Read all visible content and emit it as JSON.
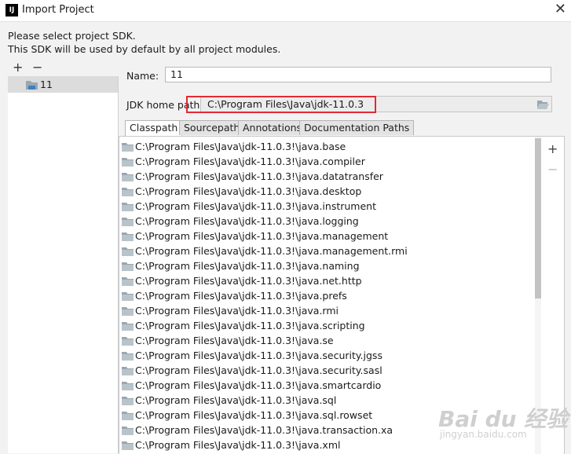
{
  "window": {
    "title": "Import Project",
    "logo_text": "IJ",
    "close_glyph": "✕"
  },
  "intro": {
    "line1": "Please select project SDK.",
    "line2": "This SDK will be used by default by all project modules."
  },
  "sdk_toolbar": {
    "add_glyph": "+",
    "remove_glyph": "−"
  },
  "sdk_list": {
    "items": [
      {
        "label": "11",
        "icon": "sdk-folder-icon"
      }
    ]
  },
  "form": {
    "name_label": "Name:",
    "name_value": "11",
    "home_label": "JDK home path:",
    "home_value": "C:\\Program Files\\Java\\jdk-11.0.3",
    "browse_icon": "folder-open-icon"
  },
  "tabs": [
    {
      "label": "Classpath",
      "active": true
    },
    {
      "label": "Sourcepath",
      "active": false
    },
    {
      "label": "Annotations",
      "active": false
    },
    {
      "label": "Documentation Paths",
      "active": false
    }
  ],
  "path_actions": {
    "add_glyph": "+",
    "remove_glyph": "−"
  },
  "classpath": [
    "C:\\Program Files\\Java\\jdk-11.0.3!\\java.base",
    "C:\\Program Files\\Java\\jdk-11.0.3!\\java.compiler",
    "C:\\Program Files\\Java\\jdk-11.0.3!\\java.datatransfer",
    "C:\\Program Files\\Java\\jdk-11.0.3!\\java.desktop",
    "C:\\Program Files\\Java\\jdk-11.0.3!\\java.instrument",
    "C:\\Program Files\\Java\\jdk-11.0.3!\\java.logging",
    "C:\\Program Files\\Java\\jdk-11.0.3!\\java.management",
    "C:\\Program Files\\Java\\jdk-11.0.3!\\java.management.rmi",
    "C:\\Program Files\\Java\\jdk-11.0.3!\\java.naming",
    "C:\\Program Files\\Java\\jdk-11.0.3!\\java.net.http",
    "C:\\Program Files\\Java\\jdk-11.0.3!\\java.prefs",
    "C:\\Program Files\\Java\\jdk-11.0.3!\\java.rmi",
    "C:\\Program Files\\Java\\jdk-11.0.3!\\java.scripting",
    "C:\\Program Files\\Java\\jdk-11.0.3!\\java.se",
    "C:\\Program Files\\Java\\jdk-11.0.3!\\java.security.jgss",
    "C:\\Program Files\\Java\\jdk-11.0.3!\\java.security.sasl",
    "C:\\Program Files\\Java\\jdk-11.0.3!\\java.smartcardio",
    "C:\\Program Files\\Java\\jdk-11.0.3!\\java.sql",
    "C:\\Program Files\\Java\\jdk-11.0.3!\\java.sql.rowset",
    "C:\\Program Files\\Java\\jdk-11.0.3!\\java.transaction.xa",
    "C:\\Program Files\\Java\\jdk-11.0.3!\\java.xml"
  ],
  "watermark": {
    "brand": "Bai du 经验",
    "site": "jingyan.baidu.com"
  },
  "colors": {
    "highlight_border": "#e02b35",
    "folder_body": "#9aa7b0",
    "folder_tab": "#b9c3ca",
    "sdk_badge": "#3d7fc1"
  }
}
